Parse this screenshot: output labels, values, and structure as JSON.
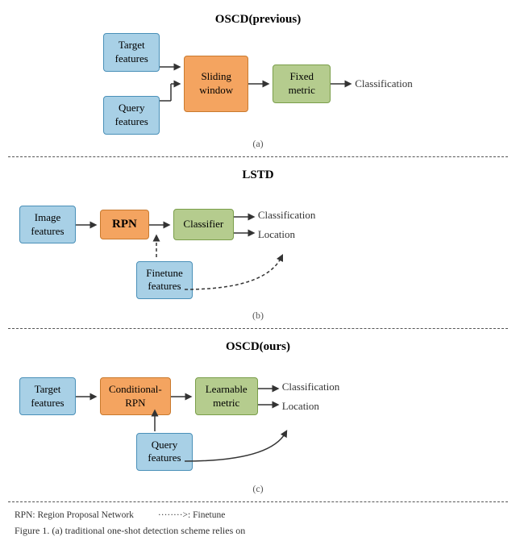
{
  "sections": {
    "a": {
      "title": "OSCD(previous)",
      "caption": "(a)",
      "boxes": {
        "target": "Target\nfeatures",
        "sliding": "Sliding\nwindow",
        "query": "Query\nfeatures",
        "fixed": "Fixed\nmetric",
        "classification": "Classification"
      }
    },
    "b": {
      "title": "LSTD",
      "caption": "(b)",
      "boxes": {
        "image": "Image\nfeatures",
        "rpn": "RPN",
        "classifier": "Classifier",
        "finetune": "Finetune\nfeatures",
        "classification": "Classification",
        "location": "Location"
      }
    },
    "c": {
      "title": "OSCD(ours)",
      "caption": "(c)",
      "boxes": {
        "target": "Target\nfeatures",
        "conditional_rpn": "Conditional-\nRPN",
        "query": "Query\nfeatures",
        "learnable": "Learnable\nmetric",
        "classification": "Classification",
        "location": "Location"
      }
    }
  },
  "footer": {
    "rpn_note": "RPN: Region Proposal Network",
    "arrow_note": "········>: Finetune"
  },
  "figure_caption": "Figure 1. (a) traditional one-shot detection scheme relies on"
}
